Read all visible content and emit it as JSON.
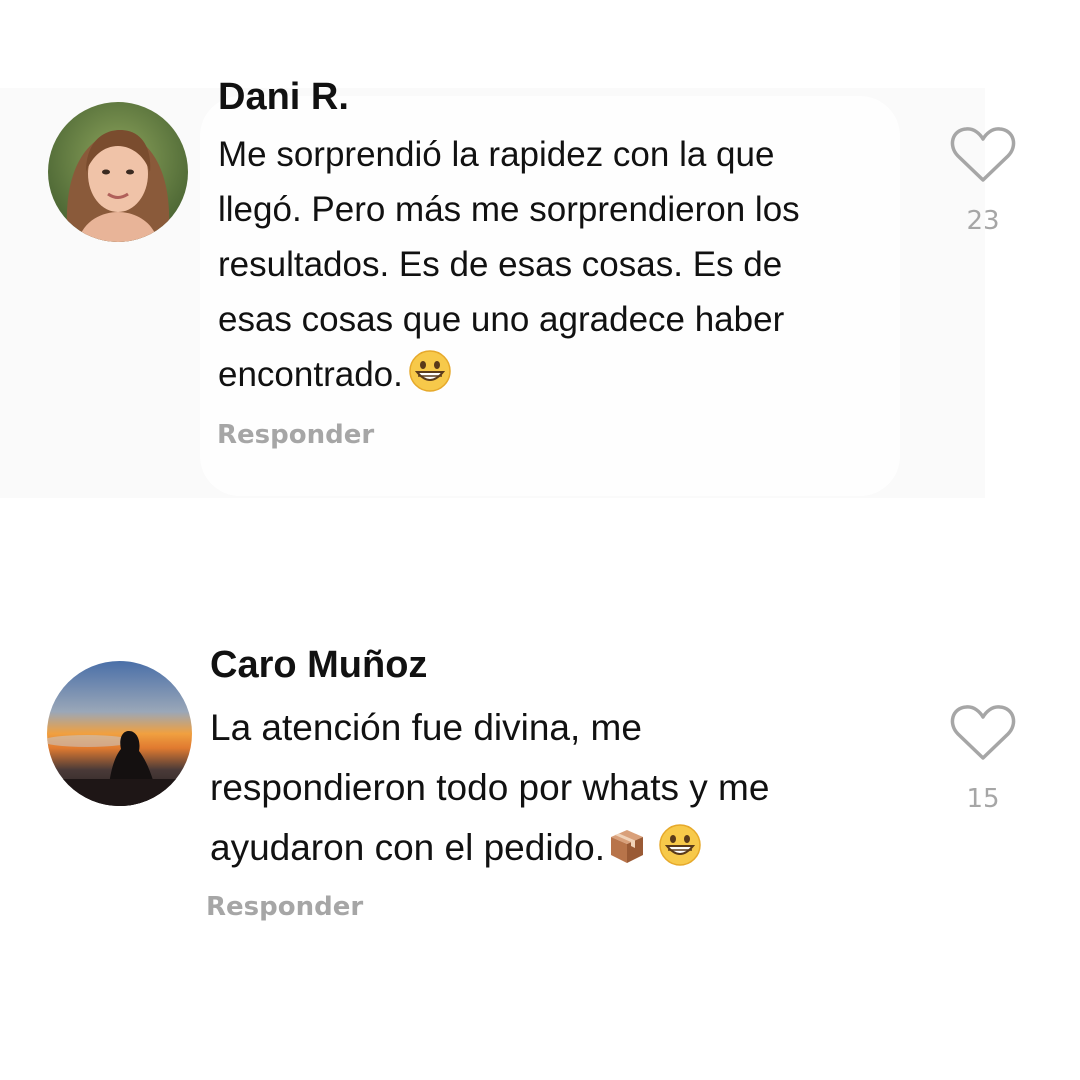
{
  "comments": [
    {
      "author": "Dani R.",
      "text": "Me sorprendió la rapidez con la que\nllegó. Pero más me sorprendieron los\nresultados. Es de esas cosas. Es de\nesas cosas que uno agradece haber\nencontrado.",
      "emojis": [
        "grinning-face"
      ],
      "reply_label": "Responder",
      "likes": "23"
    },
    {
      "author": "Caro Muñoz",
      "text": "La atención fue divina, me\nrespondieron todo por whats y me\nayudaron con el pedido.",
      "emojis": [
        "package",
        "grinning-face"
      ],
      "reply_label": "Responder",
      "likes": "15"
    }
  ],
  "icons": {
    "like": "heart-outline-icon"
  },
  "colors": {
    "text": "#111111",
    "muted": "#a6a6a6"
  }
}
